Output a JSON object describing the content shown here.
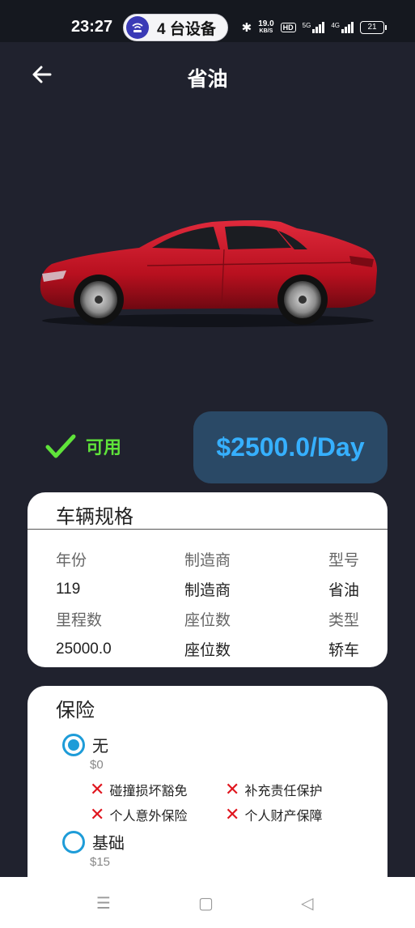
{
  "status_bar": {
    "time": "23:27",
    "devices": "4 台设备",
    "speed_value": "19.0",
    "speed_unit": "KB/S",
    "hd": "HD",
    "signal1": "5G",
    "signal2": "4G",
    "battery": "21"
  },
  "header": {
    "title": "省油"
  },
  "availability": {
    "label": "可用",
    "color": "#5fe33a"
  },
  "price": {
    "label": "$2500.0/Day"
  },
  "specs": {
    "title": "车辆规格",
    "row1_labels": [
      "年份",
      "制造商",
      "型号"
    ],
    "row1_values": [
      "119",
      "制造商",
      "省油"
    ],
    "row2_labels": [
      "里程数",
      "座位数",
      "类型"
    ],
    "row2_values": [
      "25000.0",
      "座位数",
      "轿车"
    ]
  },
  "insurance": {
    "title": "保险",
    "options": [
      {
        "label": "无",
        "price": "$0",
        "selected": true,
        "coverage": [
          "碰撞损坏豁免",
          "补充责任保护",
          "个人意外保险",
          "个人财产保障"
        ]
      },
      {
        "label": "基础",
        "price": "$15",
        "selected": false
      }
    ]
  },
  "icons": {
    "back": "back-arrow-icon",
    "check": "check-icon",
    "cross": "cross-icon"
  }
}
